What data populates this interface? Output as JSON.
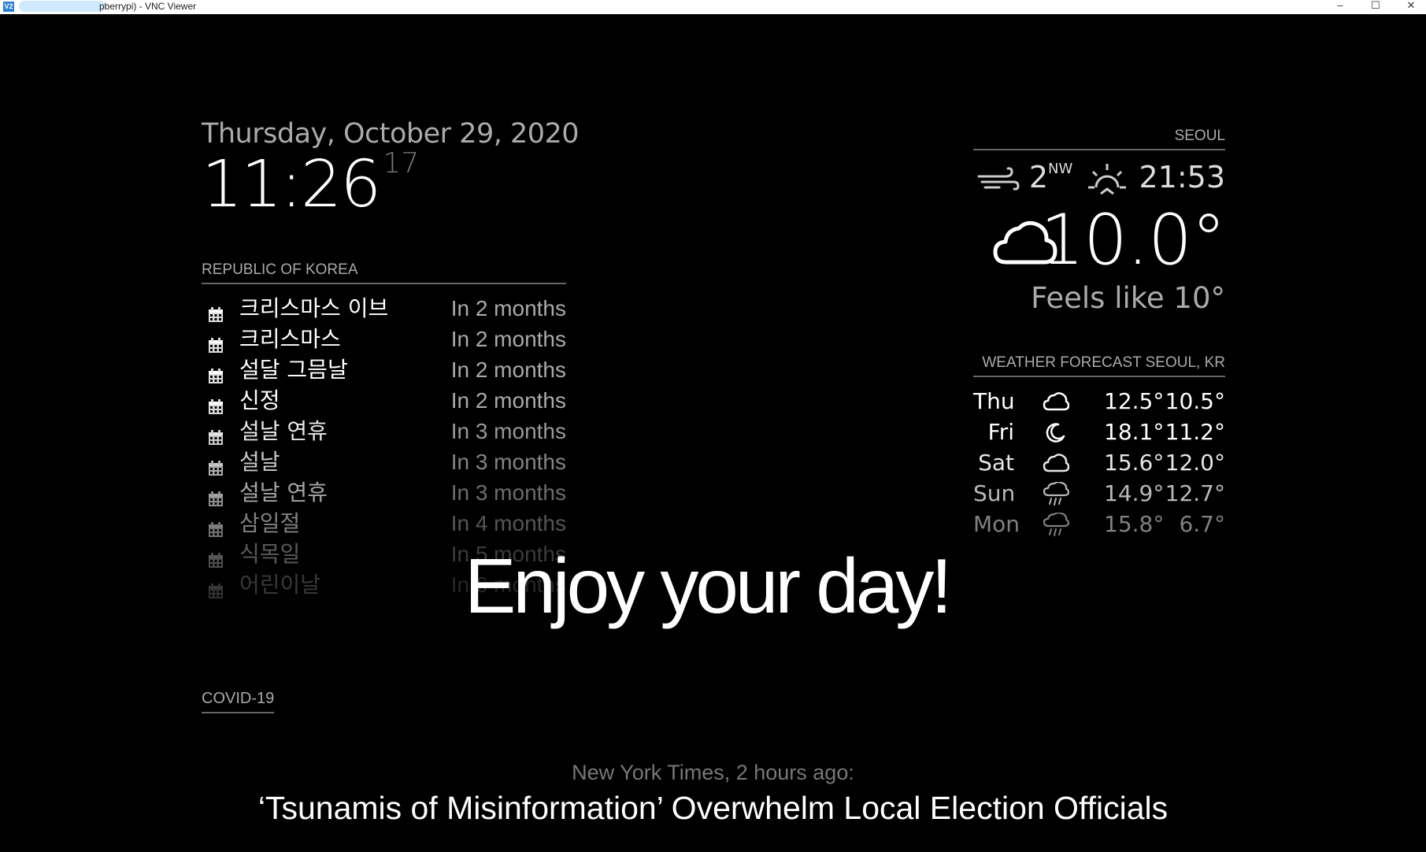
{
  "window": {
    "title": "pberrypi) - VNC Viewer",
    "app_icon_text": "V2",
    "minimize": "–",
    "maximize": "☐",
    "close": "✕"
  },
  "clock": {
    "date": "Thursday, October 29, 2020",
    "time": "11:26",
    "seconds": "17"
  },
  "calendar": {
    "header": "REPUBLIC OF KOREA",
    "icon": "calendar-icon",
    "events": [
      {
        "title": "크리스마스 이브",
        "time": "In 2 months",
        "opacity": 1.0
      },
      {
        "title": "크리스마스",
        "time": "In 2 months",
        "opacity": 1.0
      },
      {
        "title": "설달 그믐날",
        "time": "In 2 months",
        "opacity": 1.0
      },
      {
        "title": "신정",
        "time": "In 2 months",
        "opacity": 1.0
      },
      {
        "title": "설날 연휴",
        "time": "In 3 months",
        "opacity": 0.9
      },
      {
        "title": "설날",
        "time": "In 3 months",
        "opacity": 0.78
      },
      {
        "title": "설날 연휴",
        "time": "In 3 months",
        "opacity": 0.64
      },
      {
        "title": "삼일절",
        "time": "In 4 months",
        "opacity": 0.5
      },
      {
        "title": "식목일",
        "time": "In 5 months",
        "opacity": 0.35
      },
      {
        "title": "어린이날",
        "time": "In 6 months",
        "opacity": 0.22
      }
    ]
  },
  "compliment": {
    "text": "Enjoy your day!"
  },
  "covid": {
    "header": "COVID-19"
  },
  "news": {
    "source": "New York Times, 2 hours ago:",
    "headline": "‘Tsunamis of Misinformation’ Overwhelm Local Election Officials"
  },
  "current_weather": {
    "header": "SEOUL",
    "wind_speed": "2",
    "wind_direction": "NW",
    "wind_icon": "wind-icon",
    "sunset_icon": "sunset-icon",
    "sunset_time": "21:53",
    "condition_icon": "cloud-icon",
    "temperature": "10.0°",
    "feels_like": "Feels like 10°"
  },
  "forecast": {
    "header": "WEATHER FORECAST SEOUL, KR",
    "days": [
      {
        "day": "Thu",
        "icon": "cloud-icon",
        "max": "12.5°",
        "min": "10.5°",
        "opacity": 1.0
      },
      {
        "day": "Fri",
        "icon": "moon-icon",
        "max": "18.1°",
        "min": "11.2°",
        "opacity": 1.0
      },
      {
        "day": "Sat",
        "icon": "cloud-icon",
        "max": "15.6°",
        "min": "12.0°",
        "opacity": 0.9
      },
      {
        "day": "Sun",
        "icon": "rain-icon",
        "max": "14.9°",
        "min": "12.7°",
        "opacity": 0.72
      },
      {
        "day": "Mon",
        "icon": "rain-icon",
        "max": "15.8°",
        "min": "6.7°",
        "opacity": 0.5
      }
    ]
  }
}
